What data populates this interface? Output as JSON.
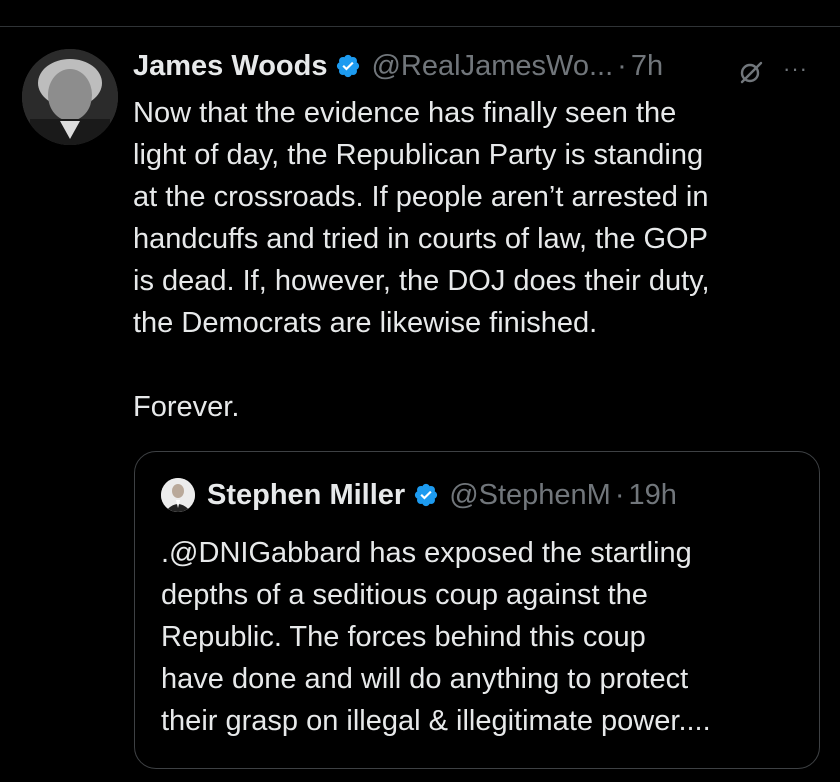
{
  "tweet": {
    "display_name": "James Woods",
    "handle": "@RealJamesWo...",
    "separator": "·",
    "time": "7h",
    "more_icon": "···",
    "text": "Now that the evidence has finally seen the\nlight of day, the Republican Party is standing\nat the crossroads. If people aren’t arrested in\nhandcuffs and tried in courts of law, the GOP\nis dead. If, however, the DOJ does their duty,\nthe Democrats are likewise finished.\n\nForever."
  },
  "quote": {
    "display_name": "Stephen Miller",
    "handle": "@StephenM",
    "separator": "·",
    "time": "19h",
    "text": ".@DNIGabbard has exposed the startling\ndepths of a seditious coup against the\nRepublic. The forces behind this coup\nhave done and will do anything to protect\ntheir grasp on illegal & illegitimate power...."
  },
  "icons": {
    "verified": "verified-badge-icon",
    "grok": "grok-icon",
    "more": "more-icon"
  },
  "colors": {
    "background": "#000000",
    "text": "#e7e9ea",
    "secondary": "#71767b",
    "verified": "#1d9bf0",
    "border": "#3e4144"
  }
}
